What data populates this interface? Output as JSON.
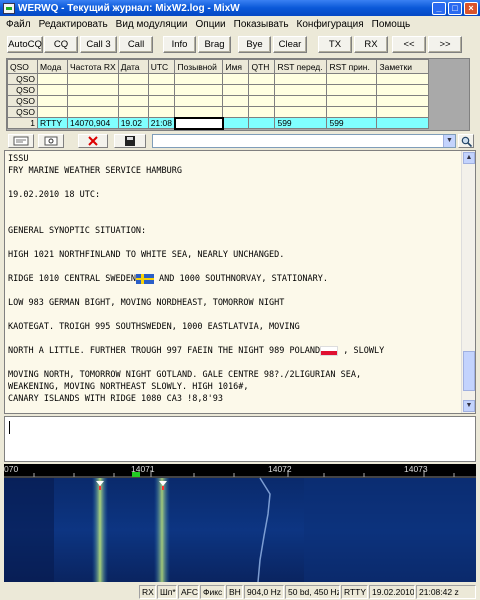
{
  "window": {
    "title": "WERWQ - Текущий журнал: MixW2.log - MixW",
    "controls": [
      "_",
      "□",
      "×"
    ]
  },
  "menu": [
    "Файл",
    "Редактировать",
    "Вид модуляции",
    "Опции",
    "Показывать",
    "Конфигурация",
    "Помощь"
  ],
  "toolbar": [
    {
      "label": "AutoCQ",
      "name": "autocq-button"
    },
    {
      "label": "CQ",
      "name": "cq-button"
    },
    {
      "label": "Call 3",
      "name": "call3-button"
    },
    {
      "label": "Call",
      "name": "call-button"
    },
    {
      "label": "Info",
      "name": "info-button"
    },
    {
      "label": "Brag",
      "name": "brag-button"
    },
    {
      "label": "Bye",
      "name": "bye-button"
    },
    {
      "label": "Clear",
      "name": "clear-button"
    },
    {
      "label": "TX",
      "name": "tx-button"
    },
    {
      "label": "RX",
      "name": "rx-button"
    },
    {
      "label": "<<",
      "name": "prev-button"
    },
    {
      "label": ">>",
      "name": "next-button"
    }
  ],
  "qso_table": {
    "columns": [
      "QSO",
      "Мода",
      "Частота RX",
      "Дата",
      "UTC",
      "Позывной",
      "Имя",
      "QTH",
      "RST перед.",
      "RST прин.",
      "Заметки"
    ],
    "empty_rows": [
      "QSO",
      "QSO",
      "QSO",
      "QSO"
    ],
    "active_row": [
      "1",
      "RTTY",
      "14070,904",
      "19.02",
      "21:08",
      "",
      "",
      "",
      "599",
      "599",
      ""
    ]
  },
  "editbar": {
    "combo_value": ""
  },
  "rx_lines": [
    "ISSU",
    "FRY MARINE WEATHER SERVICE HAMBURG",
    "",
    "19.02.2010 18 UTC:",
    "",
    "",
    "GENERAL SYNOPTIC SITUATION:",
    "",
    "HIGH 1021 NORTHFINLAND TO WHITE SEA, NEARLY UNCHANGED.",
    "",
    "RIDGE 1010 CENTRAL SWEDEN",
    " AND 1000 SOUTHNORVAY, STATIONARY.",
    "",
    "LOW 983 GERMAN BIGHT, MOVING NORDHEAST, TOMORROW NIGHT",
    "",
    "KAOTEGAT. TROIGH 995 SOUTHSWEDEN, 1000 EASTLATVIA, MOVING",
    "",
    "NORTH A LITTLE. FURTHER TROUGH 997 FAEIN THE NIGHT 989 POLAND",
    " , SLOWLY",
    "",
    "MOVING NORTH, TOMORROW NIGHT GOTLAND. GALE CENTRE 98?./2LIGURIAN SEA,",
    "WEAKENING, MOVING NORTHEAST SLOWLY. HIGH 1016#,",
    "CANARY ISLANDS WITH RIDGE 1080 CA3 !8,8'93"
  ],
  "waterfall": {
    "scale": [
      "070",
      "14071",
      "14072",
      "14073"
    ]
  },
  "status": [
    "RX",
    "Шп*",
    "AFC",
    "Фикс",
    "ВН",
    "904,0 Hz",
    "50 bd, 450 Hz",
    "RTTY",
    "19.02.2010",
    "21:08:42 z"
  ],
  "colors": {
    "titlebar": "#0a58d8",
    "qso_empty": "#ffffe1",
    "qso_active": "#80ffff",
    "rx_background": "#fcf9ea",
    "waterfall_bg": "#04103c",
    "signal": "#c8f07a"
  }
}
